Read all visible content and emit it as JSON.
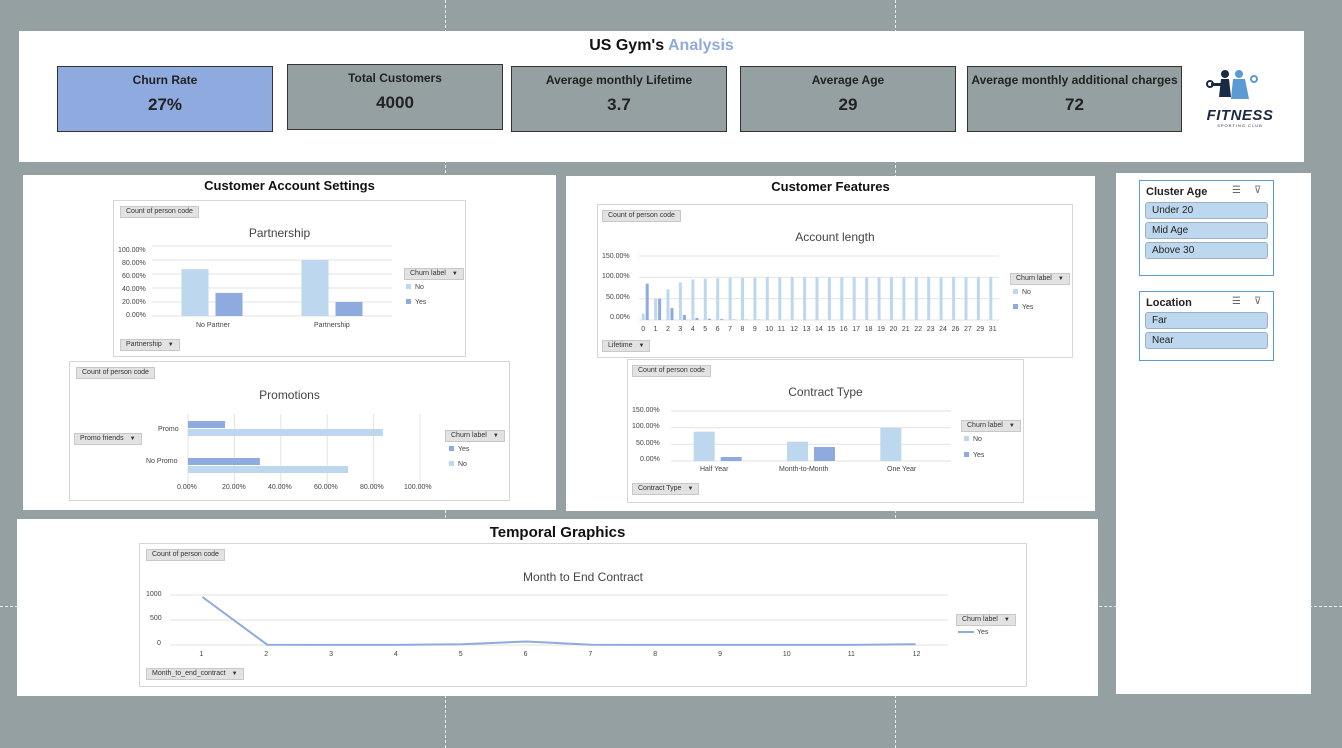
{
  "header": {
    "title_prefix": "US Gym's ",
    "title_suffix": "Analysis",
    "kpis": [
      {
        "label": "Churn Rate",
        "value": "27%"
      },
      {
        "label": "Total Customers",
        "value": "4000"
      },
      {
        "label": "Average monthly Lifetime",
        "value": "3.7"
      },
      {
        "label": "Average Age",
        "value": "29"
      },
      {
        "label": "Average monthly additional charges",
        "value": "72"
      }
    ],
    "logo": {
      "word": "FITNESS",
      "sub": "SPORTING CLUB"
    }
  },
  "sections": {
    "account": "Customer Account Settings",
    "features": "Customer Features",
    "temporal": "Temporal Graphics"
  },
  "slicers": {
    "cluster_age": {
      "title": "Cluster Age",
      "items": [
        "Under 20",
        "Mid Age",
        "Above 30"
      ]
    },
    "location": {
      "title": "Location",
      "items": [
        "Far",
        "Near"
      ]
    }
  },
  "chart_data": [
    {
      "id": "partnership",
      "type": "bar",
      "title": "Partnership",
      "measure_chip": "Count of person code",
      "field_chip": "Partnership",
      "legend_chip": "Churn label",
      "categories": [
        "No Partner",
        "Partnership"
      ],
      "y_ticks": [
        "100.00%",
        "80.00%",
        "60.00%",
        "40.00%",
        "20.00%",
        "0.00%"
      ],
      "ylim": [
        0,
        100
      ],
      "series": [
        {
          "name": "No",
          "color": "#bdd7ee",
          "values": [
            67,
            80
          ]
        },
        {
          "name": "Yes",
          "color": "#8eaade",
          "values": [
            33,
            20
          ]
        }
      ]
    },
    {
      "id": "promotions",
      "type": "bar",
      "orientation": "horizontal",
      "title": "Promotions",
      "measure_chip": "Count of person code",
      "field_chip": "Promo friends",
      "legend_chip": "Churn label",
      "categories": [
        "Promo",
        "No Promo"
      ],
      "x_ticks": [
        "0.00%",
        "20.00%",
        "40.00%",
        "60.00%",
        "80.00%",
        "100.00%"
      ],
      "xlim": [
        0,
        100
      ],
      "series": [
        {
          "name": "Yes",
          "color": "#8eaade",
          "values": [
            16,
            31
          ]
        },
        {
          "name": "No",
          "color": "#bdd7ee",
          "values": [
            84,
            69
          ]
        }
      ]
    },
    {
      "id": "account_length",
      "type": "bar",
      "title": "Account length",
      "measure_chip": "Count of person code",
      "field_chip": "Lifetime",
      "legend_chip": "Churn label",
      "categories": [
        "0",
        "1",
        "2",
        "3",
        "4",
        "5",
        "6",
        "7",
        "8",
        "9",
        "10",
        "11",
        "12",
        "13",
        "14",
        "15",
        "16",
        "17",
        "18",
        "19",
        "20",
        "21",
        "22",
        "23",
        "24",
        "26",
        "27",
        "29",
        "31"
      ],
      "y_ticks": [
        "150.00%",
        "100.00%",
        "50.00%",
        "0.00%"
      ],
      "ylim": [
        0,
        150
      ],
      "series": [
        {
          "name": "No",
          "color": "#bdd7ee",
          "values": [
            15,
            50,
            72,
            88,
            95,
            97,
            98,
            99,
            99,
            99,
            100,
            100,
            100,
            100,
            100,
            100,
            100,
            100,
            100,
            100,
            100,
            100,
            100,
            100,
            100,
            100,
            100,
            100,
            100
          ]
        },
        {
          "name": "Yes",
          "color": "#8eaade",
          "values": [
            85,
            50,
            28,
            12,
            5,
            3,
            2,
            1,
            1,
            1,
            0,
            0,
            0,
            0,
            0,
            0,
            0,
            0,
            0,
            0,
            0,
            0,
            0,
            0,
            0,
            0,
            0,
            0,
            0
          ]
        }
      ]
    },
    {
      "id": "contract_type",
      "type": "bar",
      "title": "Contract Type",
      "measure_chip": "Count of person code",
      "field_chip": "Contract Type",
      "legend_chip": "Churn label",
      "categories": [
        "Half Year",
        "Month-to-Month",
        "One Year"
      ],
      "y_ticks": [
        "150.00%",
        "100.00%",
        "50.00%",
        "0.00%"
      ],
      "ylim": [
        0,
        150
      ],
      "series": [
        {
          "name": "No",
          "color": "#bdd7ee",
          "values": [
            88,
            58,
            100
          ]
        },
        {
          "name": "Yes",
          "color": "#8eaade",
          "values": [
            12,
            42,
            0
          ]
        }
      ]
    },
    {
      "id": "month_to_end",
      "type": "line",
      "title": "Month to End Contract",
      "measure_chip": "Count of person code",
      "field_chip": "Month_to_end_contract",
      "legend_chip": "Churn label",
      "x": [
        "1",
        "2",
        "3",
        "4",
        "5",
        "6",
        "7",
        "8",
        "9",
        "10",
        "11",
        "12"
      ],
      "y_ticks": [
        "1000",
        "500",
        "0"
      ],
      "ylim": [
        0,
        1000
      ],
      "series": [
        {
          "name": "Yes",
          "color": "#8eaade",
          "values": [
            960,
            5,
            3,
            3,
            15,
            70,
            5,
            3,
            3,
            3,
            3,
            15
          ]
        }
      ]
    }
  ]
}
